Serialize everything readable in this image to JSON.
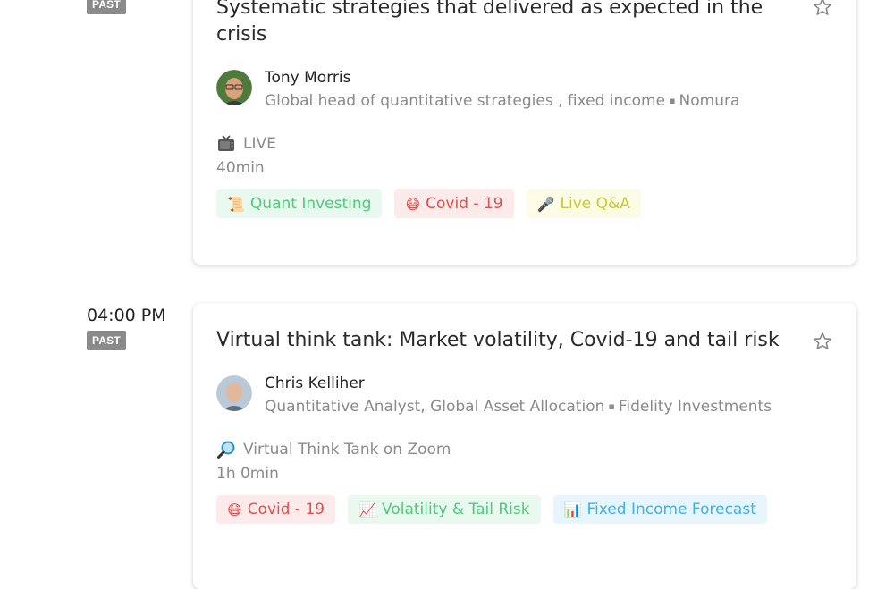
{
  "sessions": [
    {
      "badge": "PAST",
      "title": "Systematic strategies that delivered as expected in the crisis",
      "speaker_name": "Tony Morris",
      "speaker_role": "Global head of quantitative strategies , fixed income",
      "speaker_org": "Nomura",
      "format": "LIVE",
      "format_icon": "tv-icon",
      "duration": "40min",
      "tags": [
        {
          "label": "Quant Investing",
          "color": "#4fc97b",
          "bg": "#e9f9ef"
        },
        {
          "label": "Covid - 19",
          "color": "#d9534f",
          "bg": "#fdeaea"
        },
        {
          "label": "Live Q&A",
          "color": "#c9c934",
          "bg": "#fbfbe6"
        }
      ]
    },
    {
      "time": "04:00 PM",
      "badge": "PAST",
      "title": "Virtual think tank: Market volatility, Covid-19 and tail risk",
      "speaker_name": "Chris Kelliher",
      "speaker_role": "Quantitative Analyst, Global Asset Allocation",
      "speaker_org": "Fidelity Investments",
      "format": "Virtual Think Tank on Zoom",
      "format_icon": "magnifier-icon",
      "duration": "1h 0min",
      "tags": [
        {
          "label": "Covid - 19",
          "color": "#d9534f",
          "bg": "#fdeaea"
        },
        {
          "label": "Volatility & Tail Risk",
          "color": "#4fc97b",
          "bg": "#e9f9ef"
        },
        {
          "label": "Fixed Income Forecast",
          "color": "#3fb0e8",
          "bg": "#e7f6fd"
        }
      ]
    }
  ]
}
